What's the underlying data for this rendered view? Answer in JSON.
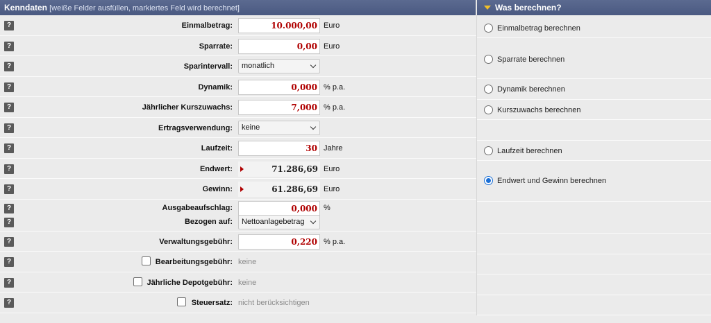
{
  "header": {
    "title": "Kenndaten",
    "subtitle": "[weiße Felder ausfüllen, markiertes Feld wird berechnet]",
    "right_title": "Was berechnen?"
  },
  "help_label": "?",
  "fields": {
    "einmalbetrag": {
      "label": "Einmalbetrag:",
      "value": "10.000,00",
      "unit": "Euro"
    },
    "sparrate": {
      "label": "Sparrate:",
      "value": "0,00",
      "unit": "Euro"
    },
    "sparintervall": {
      "label": "Sparintervall:",
      "selected": "monatlich"
    },
    "dynamik": {
      "label": "Dynamik:",
      "value": "0,000",
      "unit": "% p.a."
    },
    "kurszuwachs": {
      "label": "Jährlicher Kurszuwachs:",
      "value": "7,000",
      "unit": "% p.a."
    },
    "ertragsverwendung": {
      "label": "Ertragsverwendung:",
      "selected": "keine"
    },
    "laufzeit": {
      "label": "Laufzeit:",
      "value": "30",
      "unit": "Jahre"
    },
    "endwert": {
      "label": "Endwert:",
      "value": "71.286,69",
      "unit": "Euro"
    },
    "gewinn": {
      "label": "Gewinn:",
      "value": "61.286,69",
      "unit": "Euro"
    },
    "ausgabeaufschlag": {
      "label": "Ausgabeaufschlag:",
      "value": "0,000",
      "unit": "%"
    },
    "bezogen_auf": {
      "label": "Bezogen auf:",
      "selected": "Nettoanlagebetrag"
    },
    "verwaltungsgebuehr": {
      "label": "Verwaltungsgebühr:",
      "value": "0,220",
      "unit": "% p.a."
    },
    "bearbeitungsgebuehr": {
      "label": "Bearbeitungsgebühr:",
      "value": "keine",
      "checked": false
    },
    "depotgebuehr": {
      "label": "Jährliche Depotgebühr:",
      "value": "keine",
      "checked": false
    },
    "steuersatz": {
      "label": "Steuersatz:",
      "value": "nicht berücksichtigen",
      "checked": false
    }
  },
  "calc_options": [
    {
      "label": "Einmalbetrag berechnen",
      "selected": false
    },
    {
      "label": "Sparrate berechnen",
      "selected": false
    },
    {
      "label": "Dynamik berechnen",
      "selected": false
    },
    {
      "label": "Kurszuwachs berechnen",
      "selected": false
    },
    {
      "label": "Laufzeit berechnen",
      "selected": false
    },
    {
      "label": "Endwert und Gewinn berechnen",
      "selected": true
    }
  ],
  "colors": {
    "header": "#4f5e85",
    "accent": "#f2c029",
    "value_red": "#b00000",
    "radio_blue": "#1a6fd6"
  }
}
